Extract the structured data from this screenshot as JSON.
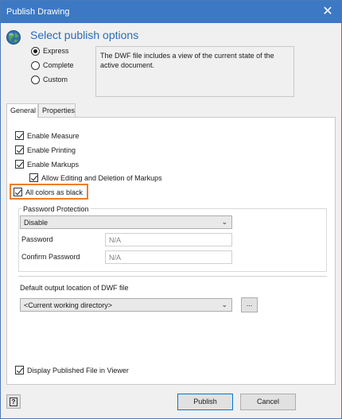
{
  "window": {
    "title": "Publish Drawing",
    "close_icon": "close-icon",
    "title_bar_color": "#3c78c4"
  },
  "header": {
    "heading": "Select publish options",
    "icon": "globe-icon",
    "heading_color": "#2b6cb5"
  },
  "publish_mode": {
    "options": [
      "Express",
      "Complete",
      "Custom"
    ],
    "selected": "Express"
  },
  "description": "The DWF file includes a view of the current state of the active document.",
  "tabs": [
    "General",
    "Properties"
  ],
  "active_tab": "General",
  "general": {
    "options": {
      "enable_measure": {
        "label": "Enable Measure",
        "checked": true
      },
      "enable_printing": {
        "label": "Enable Printing",
        "checked": true
      },
      "enable_markups": {
        "label": "Enable Markups",
        "checked": true
      },
      "allow_editing": {
        "label": "Allow Editing and Deletion of Markups",
        "checked": true
      },
      "all_colors_black": {
        "label": "All colors as black",
        "checked": true
      }
    },
    "highlight_color": "#ee7d2a",
    "password_protection": {
      "group_label": "Password Protection",
      "mode_value": "Disable",
      "password_label": "Password",
      "password_value": "N/A",
      "confirm_label": "Confirm Password",
      "confirm_value": "N/A"
    },
    "output": {
      "label": "Default output location of DWF file",
      "value": "<Current working directory>",
      "browse_label": "..."
    },
    "display_in_viewer": {
      "label": "Display Published File in Viewer",
      "checked": true
    }
  },
  "footer": {
    "help_icon": "help-icon",
    "help_glyph": "?",
    "publish_label": "Publish",
    "cancel_label": "Cancel"
  }
}
